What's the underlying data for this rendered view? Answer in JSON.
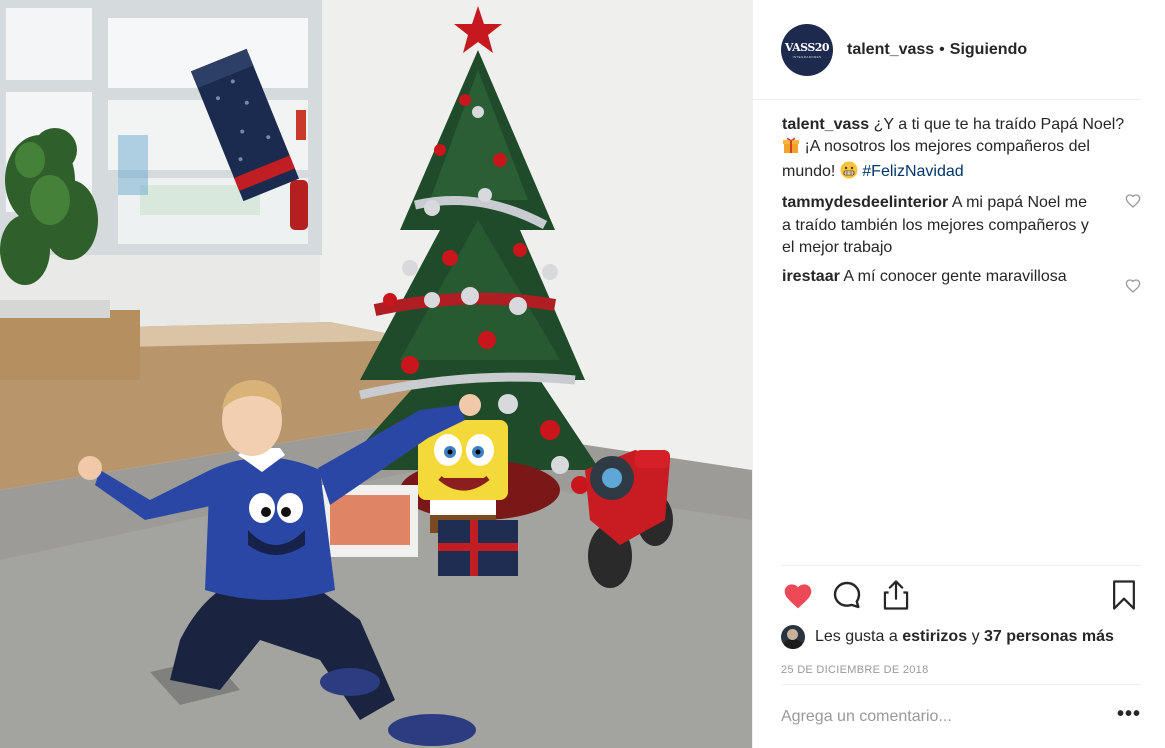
{
  "post": {
    "username": "talent_vass",
    "follow_status": "Siguiendo",
    "separator": "•",
    "avatar": {
      "logo_text": "VASS20",
      "logo_sub": "INTEGRADORES"
    },
    "caption": {
      "username": "talent_vass",
      "text_1": "¿Y a ti que te ha traído Papá Noel?",
      "emoji_gift": "gift-emoji",
      "text_2": "¡A nosotros los mejores compañeros del mundo!",
      "emoji_grin": "grimacing-emoji",
      "hashtag": "#FelizNavidad"
    },
    "comments": [
      {
        "username": "tammydesdeelinterior",
        "text": "A mi papá Noel me a traído también los mejores compañeros y el mejor trabajo"
      },
      {
        "username": "irestaar",
        "text": "A mí conocer gente maravillosa"
      }
    ],
    "likes": {
      "prefix": "Les gusta a",
      "first_user": "estirizos",
      "connector": "y",
      "others": "37 personas más"
    },
    "date": "25 DE DICIEMBRE DE 2018",
    "add_comment_placeholder": "Agrega un comentario...",
    "more_label": "•••"
  },
  "icons": {
    "like": "heart-filled-icon",
    "comment": "speech-bubble-icon",
    "share": "share-icon",
    "save": "bookmark-icon",
    "comment_like": "heart-outline-icon"
  },
  "colors": {
    "like_red": "#ed4956",
    "hashtag_blue": "#003569",
    "text_primary": "#262626",
    "text_secondary": "#999999",
    "avatar_navy": "#1d2a4d"
  }
}
